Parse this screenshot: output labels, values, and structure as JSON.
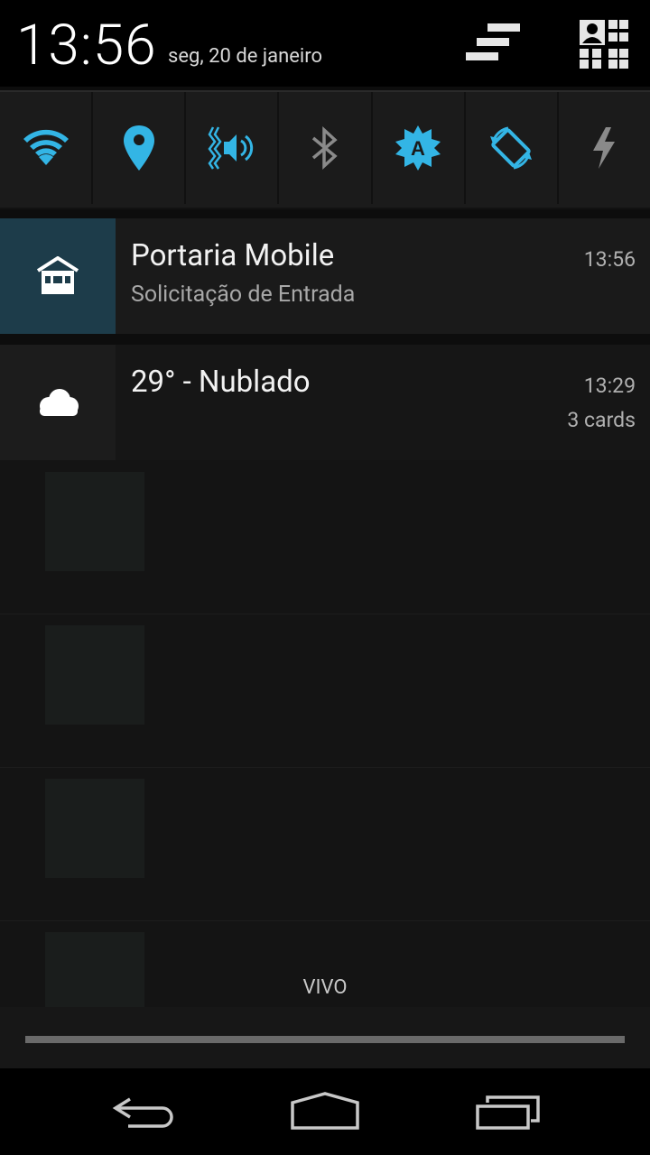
{
  "header": {
    "time": "13:56",
    "date": "seg, 20 de janeiro"
  },
  "quick_settings": [
    {
      "icon": "wifi-icon",
      "color": "#33b5e5"
    },
    {
      "icon": "location-icon",
      "color": "#33b5e5"
    },
    {
      "icon": "vibrate-sound-icon",
      "color": "#33b5e5"
    },
    {
      "icon": "bluetooth-icon",
      "color": "#8a8a8a"
    },
    {
      "icon": "auto-brightness-icon",
      "color": "#33b5e5"
    },
    {
      "icon": "auto-rotate-icon",
      "color": "#33b5e5"
    },
    {
      "icon": "flashlight-icon",
      "color": "#8a8a8a"
    }
  ],
  "notifications": [
    {
      "app_icon": "store-icon",
      "title": "Portaria Mobile",
      "subtitle": "Solicitação de Entrada",
      "time": "13:56"
    },
    {
      "app_icon": "cloud-icon",
      "title": "29° - Nublado",
      "time": "13:29",
      "info": "3 cards"
    }
  ],
  "carrier": "VIVO"
}
